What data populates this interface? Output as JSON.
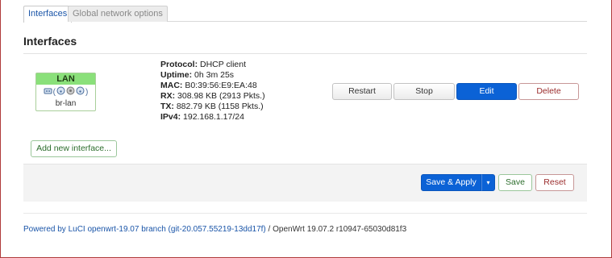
{
  "tabs": [
    {
      "label": "Interfaces",
      "active": true
    },
    {
      "label": "Global network options",
      "active": false
    }
  ],
  "section_title": "Interfaces",
  "interface": {
    "name": "LAN",
    "device": "br-lan",
    "icons": [
      "ethernet-icon",
      "wifi-icon",
      "network-icon",
      "wifi-icon"
    ],
    "status": {
      "protocol_label": "Protocol:",
      "protocol": "DHCP client",
      "uptime_label": "Uptime:",
      "uptime": "0h 3m 25s",
      "mac_label": "MAC:",
      "mac": "B0:39:56:E9:EA:48",
      "rx_label": "RX:",
      "rx": "308.98 KB (2913 Pkts.)",
      "tx_label": "TX:",
      "tx": "882.79 KB (1158 Pkts.)",
      "ipv4_label": "IPv4:",
      "ipv4": "192.168.1.17/24"
    },
    "buttons": {
      "restart": "Restart",
      "stop": "Stop",
      "edit": "Edit",
      "delete": "Delete"
    }
  },
  "add_interface_label": "Add new interface...",
  "actions": {
    "save_apply": "Save & Apply",
    "caret": "▾",
    "save": "Save",
    "reset": "Reset"
  },
  "footer": {
    "powered": "Powered by LuCI openwrt-19.07 branch (git-20.057.55219-13dd17f)",
    "version": " / OpenWrt 19.07.2 r10947-65030d81f3"
  },
  "colors": {
    "primary": "#0b62d6",
    "badge_green": "#8ae07a",
    "link_blue": "#1a55a8",
    "danger": "#9a2b2b",
    "positive": "#2c6d2c"
  }
}
